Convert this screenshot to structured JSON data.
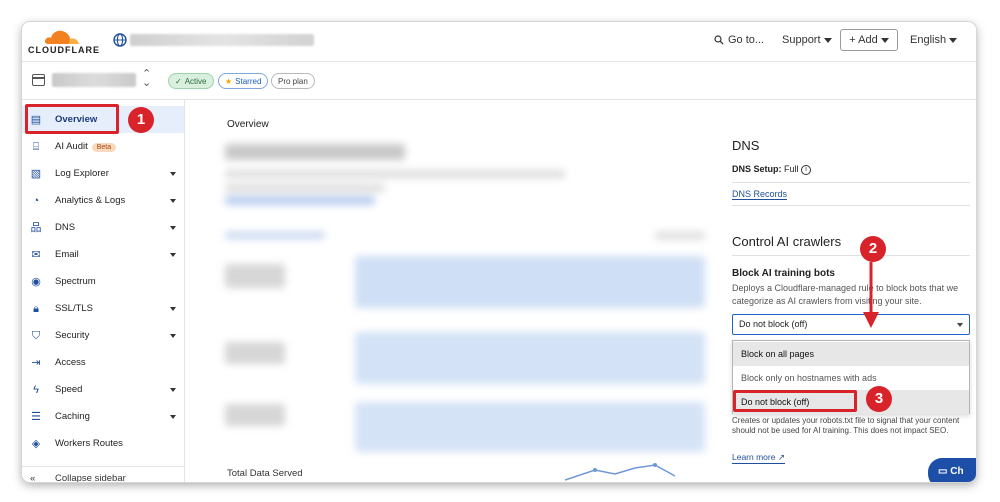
{
  "topbar": {
    "logo_text": "CLOUDFLARE",
    "goto_label": "Go to...",
    "support_label": "Support",
    "add_label": "+ Add",
    "language_label": "English"
  },
  "zonebar": {
    "active_label": "Active",
    "starred_label": "Starred",
    "plan_label": "Pro plan"
  },
  "sidebar": {
    "items": [
      {
        "label": "Overview",
        "icon": "document-icon"
      },
      {
        "label": "AI Audit",
        "icon": "ai-audit-icon",
        "badge": "Beta"
      },
      {
        "label": "Log Explorer",
        "icon": "log-explorer-icon"
      },
      {
        "label": "Analytics & Logs",
        "icon": "analytics-icon"
      },
      {
        "label": "DNS",
        "icon": "dns-icon"
      },
      {
        "label": "Email",
        "icon": "email-icon"
      },
      {
        "label": "Spectrum",
        "icon": "spectrum-icon"
      },
      {
        "label": "SSL/TLS",
        "icon": "lock-icon"
      },
      {
        "label": "Security",
        "icon": "shield-icon"
      },
      {
        "label": "Access",
        "icon": "access-icon"
      },
      {
        "label": "Speed",
        "icon": "lightning-icon"
      },
      {
        "label": "Caching",
        "icon": "caching-icon"
      },
      {
        "label": "Workers Routes",
        "icon": "workers-icon"
      }
    ],
    "collapse_label": "Collapse sidebar"
  },
  "main": {
    "title": "Overview",
    "total_data_served": "Total Data Served"
  },
  "right": {
    "dns_heading": "DNS",
    "dns_setup_label": "DNS Setup:",
    "dns_setup_value": "Full",
    "dns_records_link": "DNS Records",
    "ai_heading": "Control AI crawlers",
    "block_heading": "Block AI training bots",
    "block_desc": "Deploys a Cloudflare-managed rule to block bots that we categorize as AI crawlers from visiting your site.",
    "select_value": "Do not block (off)",
    "options": [
      "Block on all pages",
      "Block only on hostnames with ads",
      "Do not block (off)"
    ],
    "below_desc": "Creates or updates your robots.txt file to signal that your content should not be used for AI training. This does not impact SEO.",
    "learn_more": "Learn more",
    "chat_label": "Ch"
  },
  "annotations": {
    "step1": "1",
    "step2": "2",
    "step3": "3"
  },
  "colors": {
    "brand_orange": "#f48120",
    "link_blue": "#1f4f9c",
    "annotation_red": "#d8232a"
  }
}
